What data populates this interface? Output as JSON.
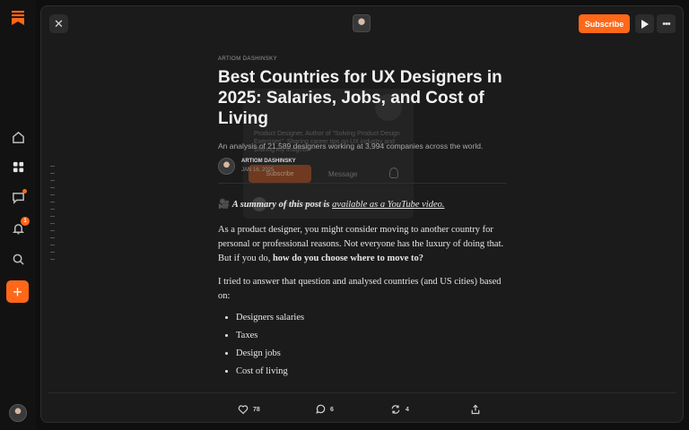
{
  "topbar": {
    "subscribe_label": "Subscribe",
    "close_icon": "close-icon",
    "more_icon": "more-icon"
  },
  "article": {
    "eyebrow": "ARTIOM DASHINSKY",
    "title": "Best Countries for UX Designers in 2025: Salaries, Jobs, and Cost of Living",
    "subtitle": "An analysis of 21,589 designers working at 3,994 companies across the world.",
    "author": "ARTIOM DASHINSKY",
    "date": "JAN 16, 2025",
    "summary_prefix": "A summary of this post is ",
    "summary_link": "available as a YouTube video.",
    "p1_text": "As a product designer, you might consider moving to another country for personal or professional reasons. Not everyone has the luxury of doing that. But if you do, ",
    "p1_bold": "how do you choose where to move to?",
    "p2": "I tried to answer that question and analysed countries (and US cities) based on:",
    "bullets": [
      "Designers salaries",
      "Taxes",
      "Design jobs",
      "Cost of living"
    ]
  },
  "ghost_card": {
    "bio": "Product Designer, Author of \"Solving Product Design Exercises\". Sharing career tips on UX industry and sharing my insights.",
    "subscribe": "Subscribe",
    "message": "Message",
    "row": "Artiom Dashinsky"
  },
  "rail": {
    "bell_count": "1"
  },
  "actions": {
    "likes": "78",
    "comments": "6",
    "restacks": "4"
  },
  "colors": {
    "accent": "#ff6719",
    "background": "#1b1b1b"
  }
}
